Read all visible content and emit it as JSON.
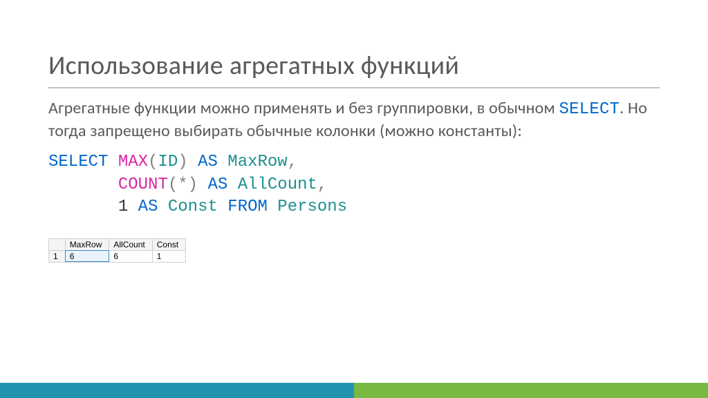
{
  "title": "Использование агрегатных функций",
  "body": {
    "part1": "Агрегатные функции можно применять и без группировки, в обычном ",
    "inline_kw": "SELECT",
    "part2": ". Но тогда запрещено выбирать обычные колонки (можно константы):"
  },
  "sql": {
    "select": "SELECT",
    "max": "MAX",
    "id": "ID",
    "as": "AS",
    "maxrow": "MaxRow",
    "count": "COUNT",
    "star": "*",
    "allcount": "AllCount",
    "one": "1",
    "const": "Const",
    "from": "FROM",
    "persons": "Persons",
    "lp": "(",
    "rp": ")",
    "comma": ","
  },
  "table": {
    "headers": [
      "MaxRow",
      "AllCount",
      "Const"
    ],
    "row_num": "1",
    "cells": [
      "6",
      "6",
      "1"
    ]
  }
}
